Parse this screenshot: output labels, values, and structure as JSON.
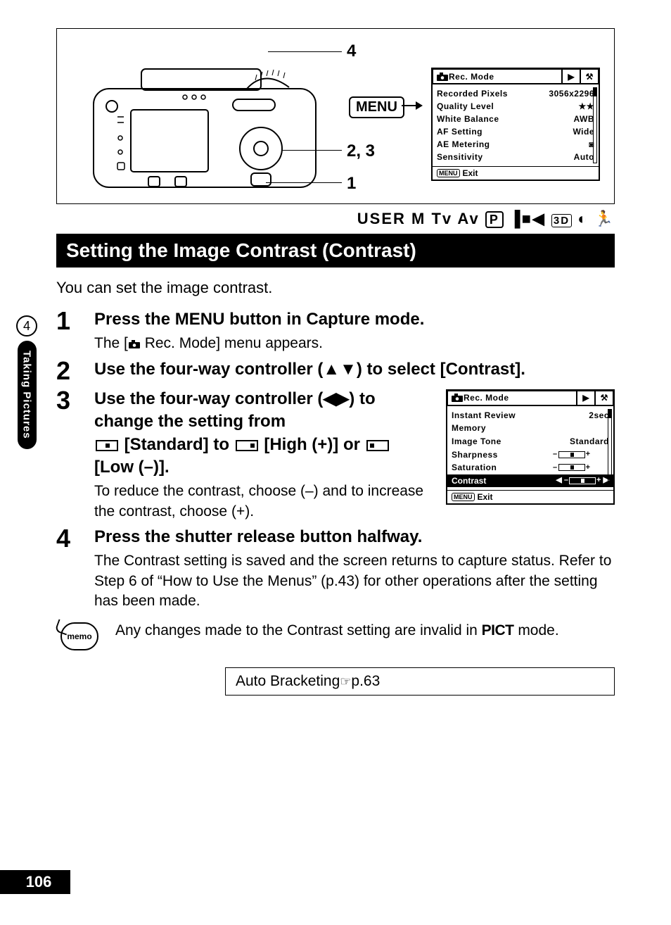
{
  "topFrame": {
    "callouts": [
      "4",
      "2, 3",
      "1"
    ],
    "menuLabel": "MENU",
    "recScreen": {
      "tabTitle": "Rec. Mode",
      "rows": [
        {
          "label": "Recorded Pixels",
          "value": "3056x2296"
        },
        {
          "label": "Quality Level",
          "value": "★★"
        },
        {
          "label": "White Balance",
          "value": "AWB"
        },
        {
          "label": "AF Setting",
          "value": "Wide"
        },
        {
          "label": "AE Metering",
          "value": "◙"
        },
        {
          "label": "Sensitivity",
          "value": "Auto"
        }
      ],
      "footerMenu": "MENU",
      "footerText": "Exit"
    }
  },
  "modeStrip": "USER M Tv Av",
  "headingBar": "Setting the Image Contrast (Contrast)",
  "intro": "You can set the image contrast.",
  "steps": {
    "s1": {
      "num": "1",
      "titlePre": "Press the ",
      "titleMenu": "MENU",
      "titlePost": " button in Capture mode.",
      "descPre": "The [",
      "descPost": " Rec. Mode] menu appears."
    },
    "s2": {
      "num": "2",
      "title": "Use the four-way controller (▲▼) to select [Contrast]."
    },
    "s3": {
      "num": "3",
      "titleLine1": "Use the four-way controller (◀▶) to change the setting from",
      "titleStd": " [Standard] to ",
      "titleHigh": " [High (+)] or ",
      "titleLow": " [Low (–)].",
      "desc": "To reduce the contrast, choose (–) and to increase the contrast, choose (+)."
    },
    "s4": {
      "num": "4",
      "title": "Press the shutter release button halfway.",
      "desc": "The Contrast setting is saved and the screen returns to capture status. Refer to Step 6 of “How to Use the Menus” (p.43) for other operations after the setting has been made."
    }
  },
  "recScreen2": {
    "tabTitle": "Rec. Mode",
    "rows": [
      {
        "label": "Instant Review",
        "value": "2sec"
      },
      {
        "label": "Memory",
        "value": ""
      },
      {
        "label": "Image Tone",
        "value": "Standard"
      },
      {
        "label": "Sharpness",
        "value": "slider"
      },
      {
        "label": "Saturation",
        "value": "slider"
      }
    ],
    "highlight": {
      "label": "Contrast",
      "value": "slider"
    },
    "footerMenu": "MENU",
    "footerText": "Exit"
  },
  "memo": {
    "iconLabel": "memo",
    "textPre": "Any changes made to the Contrast setting are invalid in ",
    "pict": "PICT",
    "textPost": " mode."
  },
  "ref": {
    "text": "Auto Bracketing ",
    "page": "p.63"
  },
  "side": {
    "num": "4",
    "label": "Taking Pictures"
  },
  "pageNumber": "106"
}
